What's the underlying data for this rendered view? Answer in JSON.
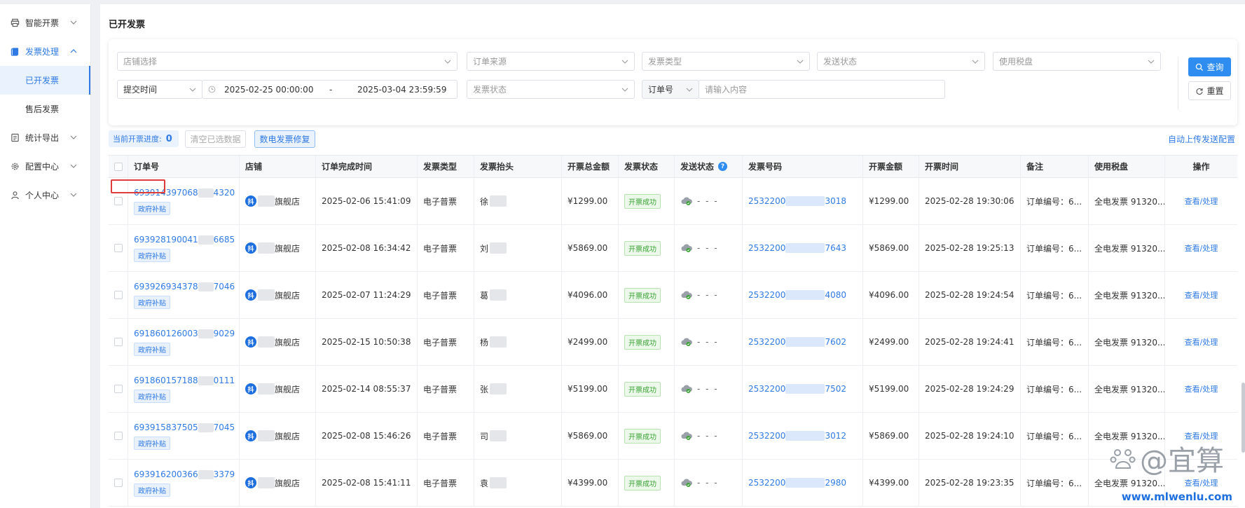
{
  "sidebar": {
    "items": [
      {
        "label": "智能开票",
        "icon": "printer-icon"
      },
      {
        "label": "发票处理",
        "icon": "invoice-icon"
      },
      {
        "label": "统计导出",
        "icon": "report-icon"
      },
      {
        "label": "配置中心",
        "icon": "settings-icon"
      },
      {
        "label": "个人中心",
        "icon": "user-icon"
      }
    ],
    "sub_items": [
      {
        "label": "已开发票"
      },
      {
        "label": "售后发票"
      }
    ]
  },
  "page": {
    "title": "已开发票"
  },
  "filters": {
    "shop_placeholder": "店铺选择",
    "order_source_placeholder": "订单来源",
    "invoice_type_placeholder": "发票类型",
    "send_status_placeholder": "发送状态",
    "tax_disk_placeholder": "使用税盘",
    "time_type": "提交时间",
    "date_start": "2025-02-25 00:00:00",
    "date_sep": "-",
    "date_end": "2025-03-04 23:59:59",
    "invoice_status_placeholder": "发票状态",
    "search_field": "订单号",
    "search_placeholder": "请输入内容",
    "query_label": "查询",
    "reset_label": "重置"
  },
  "toolbar": {
    "progress_label": "当前开票进度:",
    "progress_value": "0",
    "clear_label": "清空已选数据",
    "repair_label": "数电发票修复",
    "auto_upload_label": "自动上传发送配置"
  },
  "table": {
    "headers": [
      "订单号",
      "店铺",
      "订单完成时间",
      "发票类型",
      "发票抬头",
      "开票总金额",
      "发票状态",
      "发送状态",
      "发票号码",
      "开票金额",
      "开票时间",
      "备注",
      "使用税盘",
      "操作"
    ],
    "subsidy_tag": "政府补贴",
    "invoice_status": "开票成功",
    "send_dashes": "- - -",
    "remark": "订单编号：6...",
    "tax_disk": "全电发票 91320...",
    "action": "查看/处理",
    "shop_badge": "抖",
    "shop_suffix": "旗舰店",
    "rows": [
      {
        "order_pre": "693914397068",
        "order_post": "4320",
        "done_time": "2025-02-06 15:41:09",
        "type": "电子普票",
        "title": "徐",
        "total": "¥1299.00",
        "inv_pre": "2532200",
        "inv_post": "3018",
        "amount": "¥1299.00",
        "inv_time": "2025-02-28 19:30:06"
      },
      {
        "order_pre": "693928190041",
        "order_post": "6685",
        "done_time": "2025-02-08 16:34:42",
        "type": "电子普票",
        "title": "刘",
        "total": "¥5869.00",
        "inv_pre": "2532200",
        "inv_post": "7643",
        "amount": "¥5869.00",
        "inv_time": "2025-02-28 19:25:13"
      },
      {
        "order_pre": "693926934378",
        "order_post": "7046",
        "done_time": "2025-02-07 11:24:29",
        "type": "电子普票",
        "title": "葛",
        "total": "¥4096.00",
        "inv_pre": "2532200",
        "inv_post": "4080",
        "amount": "¥4096.00",
        "inv_time": "2025-02-28 19:24:54"
      },
      {
        "order_pre": "691860126003",
        "order_post": "9029",
        "done_time": "2025-02-15 10:50:38",
        "type": "电子普票",
        "title": "杨",
        "total": "¥2499.00",
        "inv_pre": "2532200",
        "inv_post": "7602",
        "amount": "¥2499.00",
        "inv_time": "2025-02-28 19:24:41"
      },
      {
        "order_pre": "691860157188",
        "order_post": "0111",
        "done_time": "2025-02-14 08:55:37",
        "type": "电子普票",
        "title": "张",
        "total": "¥5199.00",
        "inv_pre": "2532200",
        "inv_post": "7502",
        "amount": "¥5199.00",
        "inv_time": "2025-02-28 19:24:29"
      },
      {
        "order_pre": "693915837505",
        "order_post": "7045",
        "done_time": "2025-02-08 15:46:26",
        "type": "电子普票",
        "title": "司",
        "total": "¥5869.00",
        "inv_pre": "2532200",
        "inv_post": "3012",
        "amount": "¥5869.00",
        "inv_time": "2025-02-28 19:24:10"
      },
      {
        "order_pre": "693916200366",
        "order_post": "3379",
        "done_time": "2025-02-08 15:41:11",
        "type": "电子普票",
        "title": "袁",
        "total": "¥4399.00",
        "inv_pre": "2532200",
        "inv_post": "2980",
        "amount": "¥4399.00",
        "inv_time": "2025-02-28 19:23:35"
      }
    ]
  },
  "watermark": {
    "text": "@宜算",
    "url": "www.mlwenlu.com"
  },
  "colors": {
    "accent": "#2f7ae5",
    "primary_button": "#2f8cf0",
    "success": "#3aa335",
    "highlight_box": "#e03c3c"
  }
}
